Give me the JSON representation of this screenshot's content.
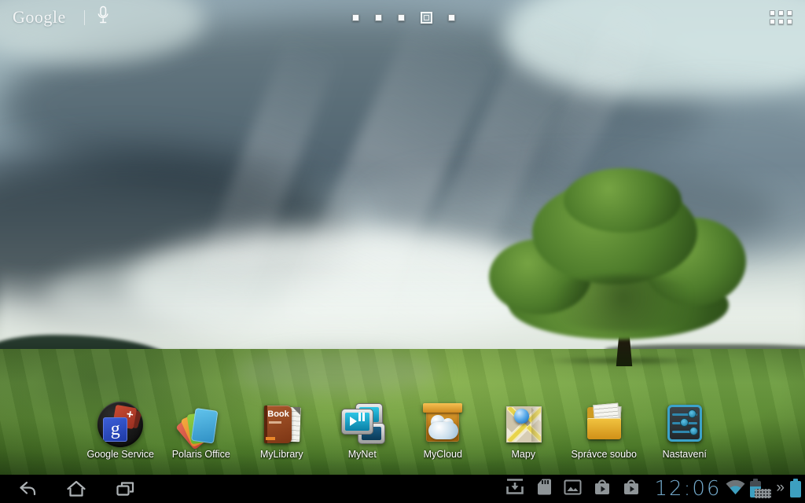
{
  "search_widget": {
    "logo": "Google",
    "mic_icon": "microphone-icon"
  },
  "pager": {
    "pages": 5,
    "active_page": 4
  },
  "launcher": {
    "all_apps_icon": "apps-grid-icon"
  },
  "dock": {
    "apps": [
      {
        "label": "Google Service",
        "icon": "google-services-icon"
      },
      {
        "label": "Polaris Office",
        "icon": "polaris-office-icon"
      },
      {
        "label": "MyLibrary",
        "icon": "book-icon"
      },
      {
        "label": "MyNet",
        "icon": "media-screens-icon"
      },
      {
        "label": "MyCloud",
        "icon": "cloud-box-icon"
      },
      {
        "label": "Mapy",
        "icon": "map-icon"
      },
      {
        "label": "Správce soubo",
        "icon": "folder-icon"
      },
      {
        "label": "Nastavení",
        "icon": "settings-sliders-icon"
      }
    ]
  },
  "icon_art": {
    "gservices_g": "g",
    "gservices_plus": "+",
    "mylibrary_title": "Book"
  },
  "system_bar": {
    "clock": "12:06",
    "expand_glyph": "»",
    "nav_icons": [
      "back",
      "home",
      "recent-apps"
    ],
    "notification_icons": [
      "download",
      "sd-card",
      "screenshot-image",
      "play-store-bag",
      "play-store-bag"
    ],
    "status_icons": [
      "wifi",
      "battery-pad",
      "dock-keyboard",
      "expand",
      "battery-dock"
    ]
  },
  "colors": {
    "holo_blue": "#3d9fc0",
    "clock_blue": "#73a9cb",
    "grass_green": "#5c8c33",
    "sky_gray": "#8ba2ac",
    "bar_black": "#000000"
  }
}
